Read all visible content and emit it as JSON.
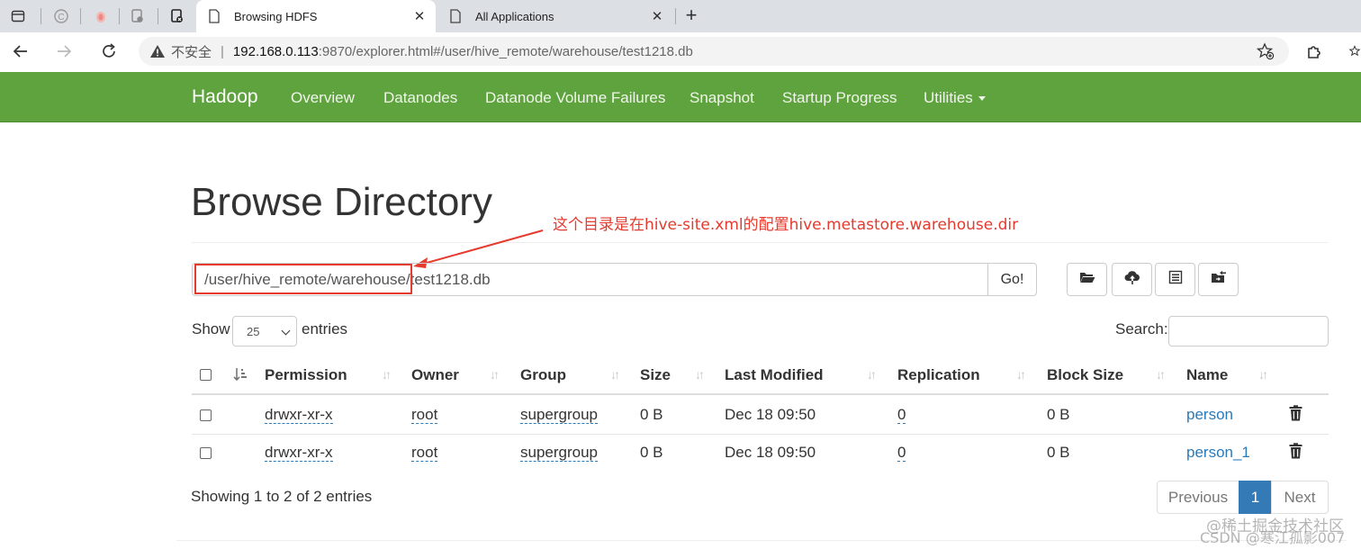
{
  "browser": {
    "tabs": [
      {
        "label": "Browsing HDFS",
        "active": true
      },
      {
        "label": "All Applications",
        "active": false
      }
    ],
    "address": {
      "insecure_label": "不安全",
      "host": "192.168.0.113",
      "rest": ":9870/explorer.html#/user/hive_remote/warehouse/test1218.db"
    }
  },
  "nav": {
    "brand": "Hadoop",
    "items": [
      "Overview",
      "Datanodes",
      "Datanode Volume Failures",
      "Snapshot",
      "Startup Progress",
      "Utilities"
    ]
  },
  "page": {
    "title": "Browse Directory",
    "annotation": "这个目录是在hive-site.xml的配置hive.metastore.warehouse.dir",
    "path_value": "/user/hive_remote/warehouse/test1218.db",
    "go_label": "Go!",
    "show_label": "Show",
    "entries_label": "entries",
    "page_length": "25",
    "search_label": "Search:",
    "search_value": ""
  },
  "table": {
    "columns": [
      "Permission",
      "Owner",
      "Group",
      "Size",
      "Last Modified",
      "Replication",
      "Block Size",
      "Name"
    ],
    "rows": [
      {
        "permission": "drwxr-xr-x",
        "owner": "root",
        "group": "supergroup",
        "size": "0 B",
        "modified": "Dec 18 09:50",
        "replication": "0",
        "block_size": "0 B",
        "name": "person"
      },
      {
        "permission": "drwxr-xr-x",
        "owner": "root",
        "group": "supergroup",
        "size": "0 B",
        "modified": "Dec 18 09:50",
        "replication": "0",
        "block_size": "0 B",
        "name": "person_1"
      }
    ]
  },
  "footer": {
    "info": "Showing 1 to 2 of 2 entries",
    "prev_label": "Previous",
    "current_page": "1",
    "next_label": "Next"
  },
  "watermark": {
    "line1": "@稀土掘金技术社区",
    "line2": "CSDN @寒江孤影007"
  },
  "colors": {
    "nav_bg": "#5fa33e",
    "link": "#2a7ab8",
    "annotation": "#e53a2e",
    "pager_active": "#337ab7"
  }
}
